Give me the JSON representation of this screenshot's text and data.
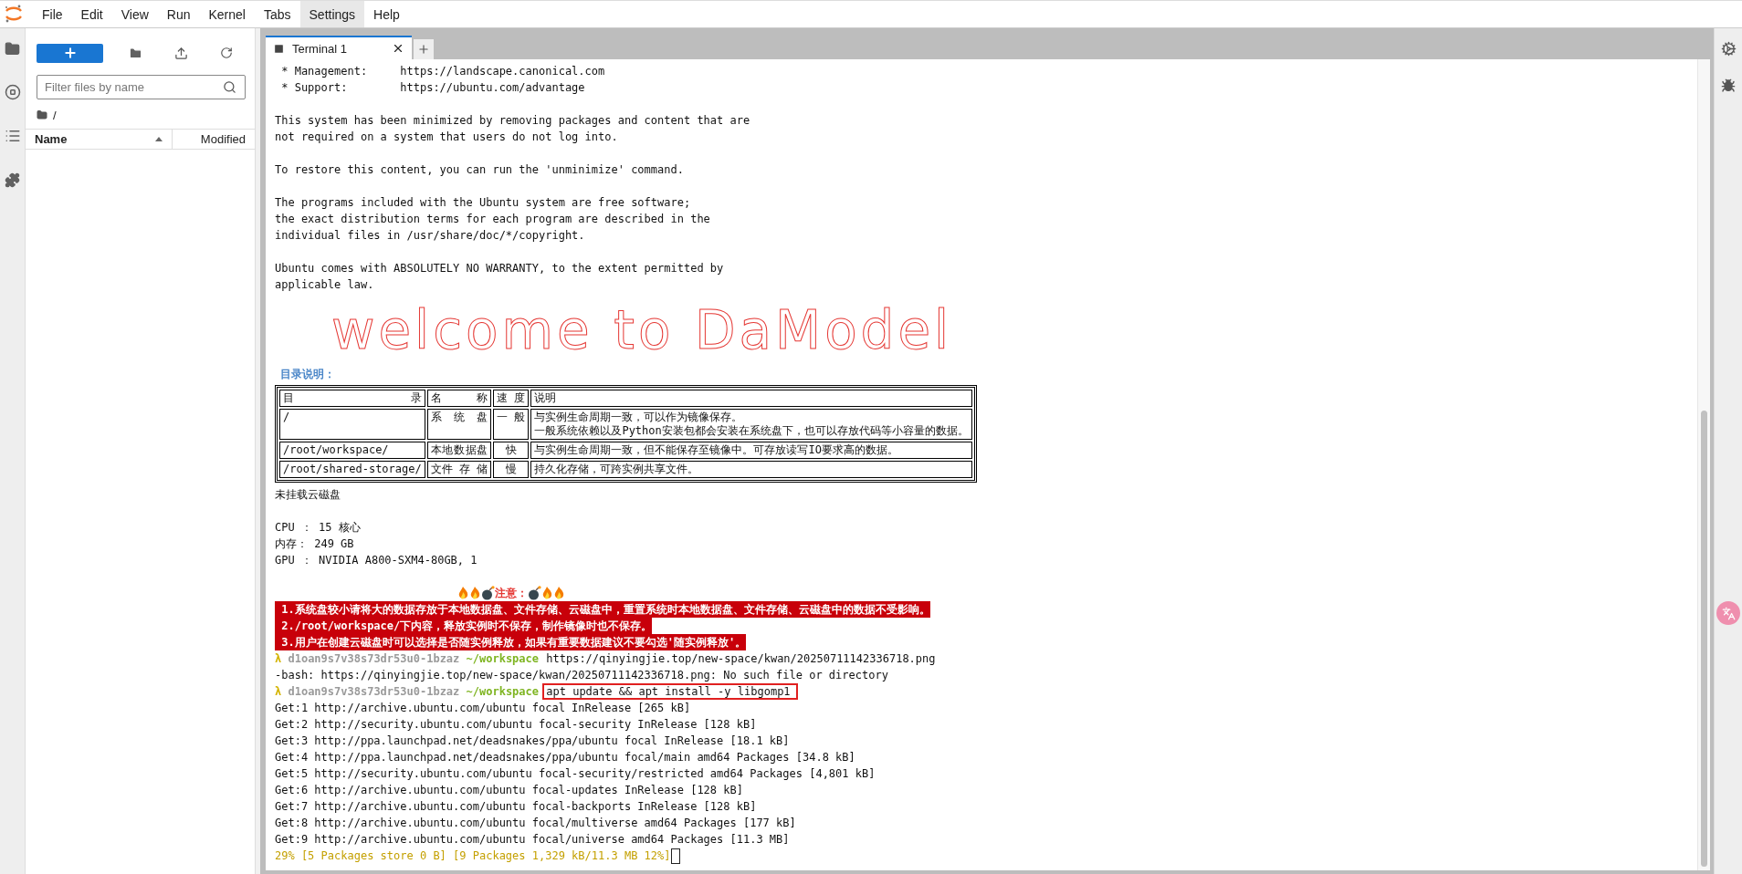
{
  "menu": [
    {
      "label": "File",
      "selected": false
    },
    {
      "label": "Edit",
      "selected": false
    },
    {
      "label": "View",
      "selected": false
    },
    {
      "label": "Run",
      "selected": false
    },
    {
      "label": "Kernel",
      "selected": false
    },
    {
      "label": "Tabs",
      "selected": false
    },
    {
      "label": "Settings",
      "selected": true
    },
    {
      "label": "Help",
      "selected": false
    }
  ],
  "file_browser": {
    "filter": {
      "placeholder": "Filter files by name"
    },
    "path": "/",
    "columns": [
      {
        "label": "Name",
        "sorted": true
      },
      {
        "label": "Modified",
        "sorted": false
      }
    ]
  },
  "tabs": [
    {
      "label": "Terminal 1",
      "selected": true
    }
  ],
  "terminal": {
    "lines": [
      {
        "kind": "text",
        "text": " * Management:     https://landscape.canonical.com"
      },
      {
        "kind": "text",
        "text": " * Support:        https://ubuntu.com/advantage"
      },
      {
        "kind": "blank"
      },
      {
        "kind": "text",
        "text": "This system has been minimized by removing packages and content that are"
      },
      {
        "kind": "text",
        "text": "not required on a system that users do not log into."
      },
      {
        "kind": "blank"
      },
      {
        "kind": "text",
        "text": "To restore this content, you can run the 'unminimize' command."
      },
      {
        "kind": "blank"
      },
      {
        "kind": "text",
        "text": "The programs included with the Ubuntu system are free software;"
      },
      {
        "kind": "text",
        "text": "the exact distribution terms for each program are described in the"
      },
      {
        "kind": "text",
        "text": "individual files in /usr/share/doc/*/copyright."
      },
      {
        "kind": "blank"
      },
      {
        "kind": "text",
        "text": "Ubuntu comes with ABSOLUTELY NO WARRANTY, to the extent permitted by"
      },
      {
        "kind": "text",
        "text": "applicable law."
      },
      {
        "kind": "banner",
        "text": "welcome to DaModel"
      },
      {
        "kind": "heading",
        "text": "目录说明："
      },
      {
        "kind": "table",
        "columns": [
          "目 录",
          "名 称",
          "速 度",
          "说明"
        ],
        "rows": [
          {
            "cells": [
              [
                "/"
              ],
              [
                "系 统 盘"
              ],
              [
                "一 般"
              ],
              [
                "与实例生命周期一致，可以作为镜像保存。",
                "一般系统依赖以及Python安装包都会安装在系统盘下，也可以存放代码等小容量的数据。"
              ]
            ]
          },
          {
            "cells": [
              [
                "/root/workspace/"
              ],
              [
                "本地数据盘"
              ],
              [
                "快"
              ],
              [
                "与实例生命周期一致，但不能保存至镜像中。可存放读写IO要求高的数据。"
              ]
            ]
          },
          {
            "cells": [
              [
                "/root/shared-storage/"
              ],
              [
                "文件 存 储"
              ],
              [
                "慢"
              ],
              [
                "持久化存储，可跨实例共享文件。"
              ]
            ]
          }
        ]
      },
      {
        "kind": "text",
        "text": "未挂载云磁盘"
      },
      {
        "kind": "blank"
      },
      {
        "kind": "text",
        "text": "CPU ： 15 核心"
      },
      {
        "kind": "text",
        "text": "内存： 249 GB"
      },
      {
        "kind": "text",
        "text": "GPU ： NVIDIA A800-SXM4-80GB, 1"
      },
      {
        "kind": "blank"
      },
      {
        "kind": "notice_title",
        "text": "注意："
      },
      {
        "kind": "notice",
        "text": " 1.系统盘较小请将大的数据存放于本地数据盘、文件存储、云磁盘中，重置系统时本地数据盘、文件存储、云磁盘中的数据不受影响。"
      },
      {
        "kind": "notice",
        "text": " 2./root/workspace/下内容，释放实例时不保存，制作镜像时也不保存。"
      },
      {
        "kind": "notice",
        "text": " 3.用户在创建云磁盘时可以选择是否随实例释放，如果有重要数据建议不要勾选'随实例释放'。"
      },
      {
        "kind": "prompt",
        "symbol": "λ",
        "user": "d1oan9s7v38s73dr53u0-1bzaz",
        "cwd": "~/workspace",
        "command": "https://qinyingjie.top/new-space/kwan/20250711142336718.png",
        "highlighted": false
      },
      {
        "kind": "text",
        "text": "-bash: https://qinyingjie.top/new-space/kwan/20250711142336718.png: No such file or directory"
      },
      {
        "kind": "prompt",
        "symbol": "λ",
        "user": "d1oan9s7v38s73dr53u0-1bzaz",
        "cwd": "~/workspace",
        "command": "apt update && apt install -y libgomp1",
        "highlighted": true
      },
      {
        "kind": "text",
        "text": "Get:1 http://archive.ubuntu.com/ubuntu focal InRelease [265 kB]"
      },
      {
        "kind": "text",
        "text": "Get:2 http://security.ubuntu.com/ubuntu focal-security InRelease [128 kB]"
      },
      {
        "kind": "text",
        "text": "Get:3 http://ppa.launchpad.net/deadsnakes/ppa/ubuntu focal InRelease [18.1 kB]"
      },
      {
        "kind": "text",
        "text": "Get:4 http://ppa.launchpad.net/deadsnakes/ppa/ubuntu focal/main amd64 Packages [34.8 kB]"
      },
      {
        "kind": "text",
        "text": "Get:5 http://security.ubuntu.com/ubuntu focal-security/restricted amd64 Packages [4,801 kB]"
      },
      {
        "kind": "text",
        "text": "Get:6 http://archive.ubuntu.com/ubuntu focal-updates InRelease [128 kB]"
      },
      {
        "kind": "text",
        "text": "Get:7 http://archive.ubuntu.com/ubuntu focal-backports InRelease [128 kB]"
      },
      {
        "kind": "text",
        "text": "Get:8 http://archive.ubuntu.com/ubuntu focal/multiverse amd64 Packages [177 kB]"
      },
      {
        "kind": "text",
        "text": "Get:9 http://archive.ubuntu.com/ubuntu focal/universe amd64 Packages [11.3 MB]"
      },
      {
        "kind": "progress",
        "text": "29% [5 Packages store 0 B] [9 Packages 1,329 kB/11.3 MB 12%]"
      }
    ]
  }
}
